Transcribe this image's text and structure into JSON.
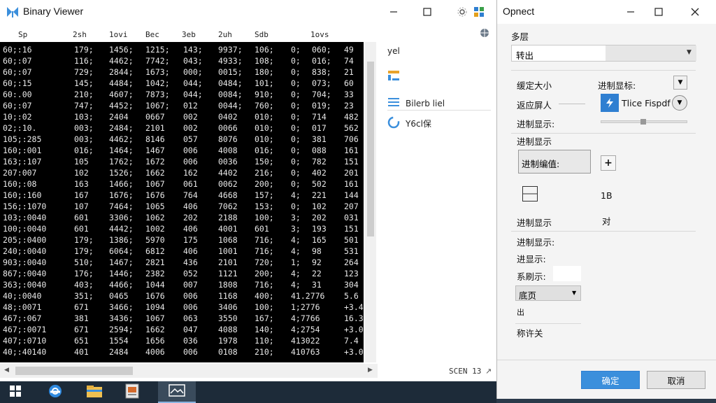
{
  "main_window": {
    "title": "Binary Viewer",
    "columns": [
      "Sp",
      "2sh",
      "1ovi",
      "Bec",
      "3eb",
      "2uh",
      "Sdb",
      "1ovs"
    ],
    "hex_rows": [
      [
        "60;:16",
        "179;",
        "1456;",
        "1215;",
        "143;",
        "9937;",
        "106;",
        "0;",
        "060;",
        "49"
      ],
      [
        "60;:07",
        "116;",
        "4462;",
        "7742;",
        "043;",
        "4933;",
        "108;",
        "0;",
        "016;",
        "74"
      ],
      [
        "60;:07",
        "729;",
        "2844;",
        "1673;",
        "000;",
        "0015;",
        "180;",
        "0;",
        "838;",
        "21"
      ],
      [
        "60;:15",
        "145;",
        "4484;",
        "1042;",
        "044;",
        "0484;",
        "101;",
        "0;",
        "073;",
        "60"
      ],
      [
        "60:.00",
        "210;",
        "4607;",
        "7873;",
        "044;",
        "0084;",
        "910;",
        "0;",
        "704;",
        "33"
      ],
      [
        "60;:07",
        "747;",
        "4452;",
        "1067;",
        "012",
        "0044;",
        "760;",
        "0;",
        "019;",
        "23"
      ],
      [
        "10;:02",
        "103;",
        "2404",
        "0667",
        "002",
        "0402",
        "010;",
        "0;",
        "714",
        "482"
      ],
      [
        "02;:10.",
        "003;",
        "2484;",
        "2101",
        "002",
        "0066",
        "010;",
        "0;",
        "017",
        "562"
      ],
      [
        "105;:285",
        "003;",
        "4462;",
        "8146",
        "057",
        "8076",
        "010;",
        "0;",
        "381",
        "706"
      ],
      [
        "160;:001",
        "016;",
        "1464;",
        "1467",
        "006",
        "4008",
        "016;",
        "0;",
        "088",
        "161"
      ],
      [
        "163;:107",
        "105",
        "1762;",
        "1672",
        "006",
        "0036",
        "150;",
        "0;",
        "782",
        "151"
      ],
      [
        "207:007",
        "102",
        "1526;",
        "1662",
        "162",
        "4402",
        "216;",
        "0;",
        "402",
        "201"
      ],
      [
        "160;:08",
        "163",
        "1466;",
        "1067",
        "061",
        "0062",
        "200;",
        "0;",
        "502",
        "161"
      ],
      [
        "160;:160",
        "167",
        "1676;",
        "1676",
        "764",
        "4668",
        "157;",
        "4;",
        "221",
        "144"
      ],
      [
        "156;:1070",
        "107",
        "7464;",
        "1065",
        "406",
        "7062",
        "153;",
        "0;",
        "102",
        "207"
      ],
      [
        "103;:0040",
        "601",
        "3306;",
        "1062",
        "202",
        "2188",
        "100;",
        "3;",
        "202",
        "031"
      ],
      [
        "100;:0040",
        "601",
        "4442;",
        "1002",
        "406",
        "4001",
        "601",
        "3;",
        "193",
        "151"
      ],
      [
        "205;:0400",
        "179;",
        "1386;",
        "5970",
        "175",
        "1068",
        "716;",
        "4;",
        "165",
        "501"
      ],
      [
        "240;:0040",
        "179;",
        "6064;",
        "6812",
        "406",
        "1001",
        "716;",
        "4;",
        "98",
        "531"
      ],
      [
        "903;:0040",
        "510;",
        "1467;",
        "2821",
        "436",
        "2101",
        "720;",
        "1;",
        "92",
        "264"
      ],
      [
        "867;:0040",
        "176;",
        "1446;",
        "2382",
        "052",
        "1121",
        "200;",
        "4;",
        "22",
        "123"
      ],
      [
        "363;:0040",
        "403;",
        "4466;",
        "1044",
        "007",
        "1808",
        "716;",
        "4;",
        "31",
        "304"
      ],
      [
        "40;:0040",
        "351;",
        "0465",
        "1676",
        "006",
        "1168",
        "400;",
        "41.2776",
        "",
        "5.6"
      ],
      [
        "48;:0071",
        "671",
        "3466;",
        "1094",
        "006",
        "3406",
        "100;",
        "1;2776",
        "",
        "+3.4"
      ],
      [
        "467;:067",
        "381",
        "3436;",
        "1067",
        "063",
        "3550",
        "167;",
        "4;7766",
        "",
        "16.3"
      ],
      [
        "467;:0071",
        "671",
        "2594;",
        "1662",
        "047",
        "4088",
        "140;",
        "4;2754",
        "",
        "+3.0"
      ],
      [
        "407;:0710",
        "651",
        "1554",
        "1656",
        "036",
        "1978",
        "110;",
        "413022",
        "",
        "7.4"
      ],
      [
        "40;:40140",
        "401",
        "2484",
        "4006",
        "006",
        "0108",
        "210;",
        "410763",
        "",
        "+3.0"
      ]
    ],
    "side_items": [
      {
        "label": "yel",
        "icon": "text-icon"
      },
      {
        "label": "",
        "icon": "table-icon"
      },
      {
        "label": "Bilerb liel",
        "icon": "list-icon"
      },
      {
        "label": "Y6cl保",
        "icon": "refresh-icon"
      }
    ],
    "status_text": "SCEN 13",
    "colors": {
      "hex_bg": "#000000",
      "hex_text": "#e8e8e8",
      "accent": "#3b8fdc"
    }
  },
  "dialog": {
    "title": "Opnect",
    "section_label": "多层",
    "select_value": "转出",
    "row1_left": "缓定大小",
    "row1_right": "进制显标:",
    "row2_left": "返应屏人",
    "row2_button": "Tlice Fispdf",
    "row3_left": "进制显示:",
    "group2_label": "进制显示",
    "input_value": "进制编值:",
    "size_label": "1B",
    "row_bin_left": "进制显示",
    "row_bin_right": "对",
    "group3_label": "进制显示:",
    "row_a": "进显示:",
    "row_b": "系刷示:",
    "dropdown_value": "底页",
    "small_label": "出",
    "footer_label": "称许关",
    "ok_label": "确定",
    "cancel_label": "取消"
  }
}
